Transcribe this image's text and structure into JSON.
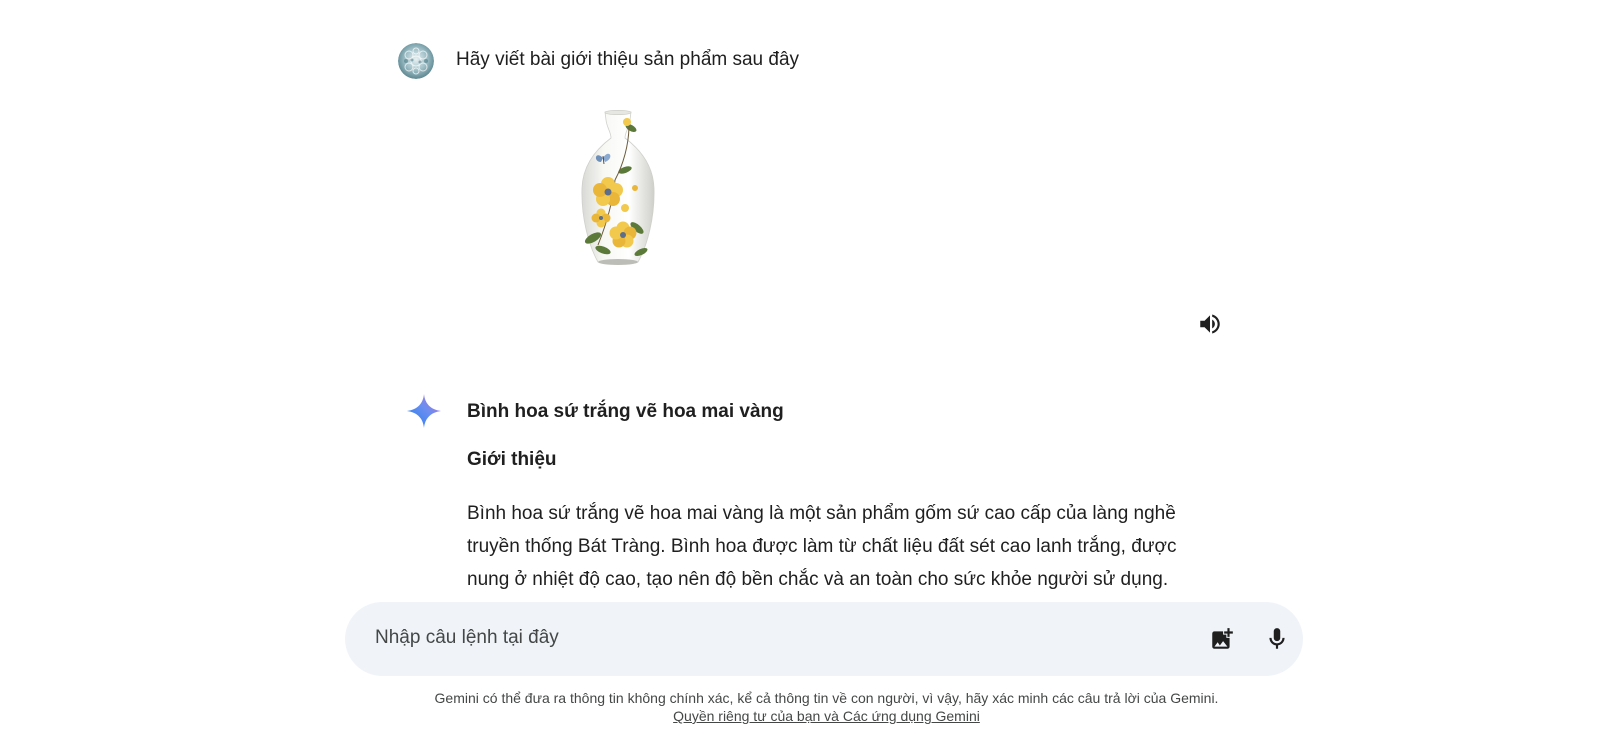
{
  "conversation": {
    "user_prompt": "Hãy viết bài giới thiệu sản phẩm sau đây",
    "user_avatar_icon": "user-avatar",
    "attached_image_icon": "vase-image",
    "speaker_icon": "volume-up-icon"
  },
  "response": {
    "logo_icon": "gemini-sparkle-icon",
    "title": "Bình hoa sứ trắng vẽ hoa mai vàng",
    "heading": "Giới thiệu",
    "paragraph_lines": [
      "Bình hoa sứ trắng vẽ hoa mai vàng là một sản phẩm gốm sứ cao cấp của làng nghề",
      "truyền thống Bát Tràng. Bình hoa được làm từ chất liệu đất sét cao lanh trắng, được",
      "nung ở nhiệt độ cao, tạo nên độ bền chắc và an toàn cho sức khỏe người sử dụng."
    ]
  },
  "input": {
    "placeholder": "Nhập câu lệnh tại đây",
    "image_button_icon": "add-photo-icon",
    "mic_button_icon": "microphone-icon"
  },
  "footer": {
    "disclaimer": "Gemini có thể đưa ra thông tin không chính xác, kể cả thông tin về con người, vì vậy, hãy xác minh các câu trả lời của Gemini.",
    "privacy_link": "Quyền riêng tư của bạn và Các ứng dụng Gemini"
  },
  "colors": {
    "input_bg": "#f0f4f9",
    "text": "#1f1f1f",
    "muted_text": "#444746"
  }
}
